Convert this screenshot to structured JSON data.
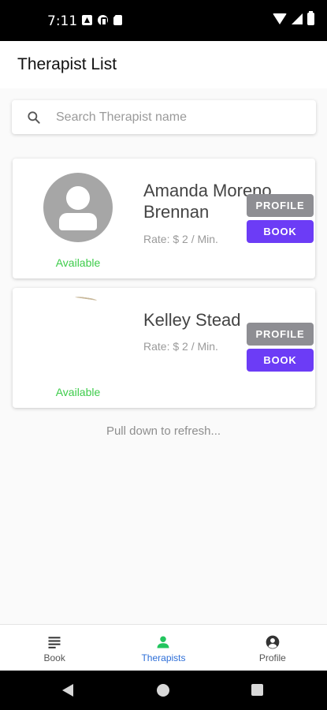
{
  "status_bar": {
    "time": "7:11"
  },
  "app_bar": {
    "title": "Therapist List"
  },
  "search": {
    "placeholder": "Search Therapist name",
    "value": ""
  },
  "therapists": [
    {
      "name_line1": "Amanda Moreno",
      "name_line2": "Brennan",
      "rate": "Rate: $ 2 / Min.",
      "availability": "Available",
      "profile_label": "PROFILE",
      "book_label": "BOOK"
    },
    {
      "name_line1": "Kelley Stead",
      "rate": "Rate: $ 2 / Min.",
      "availability": "Available",
      "profile_label": "PROFILE",
      "book_label": "BOOK"
    }
  ],
  "refresh_hint": "Pull down to refresh...",
  "bottom_nav": {
    "items": [
      {
        "label": "Book",
        "icon": "list-icon",
        "active": false
      },
      {
        "label": "Therapists",
        "icon": "person-icon",
        "active": true
      },
      {
        "label": "Profile",
        "icon": "account-circle-icon",
        "active": false
      }
    ]
  },
  "colors": {
    "accent_purple": "#6c3cf6",
    "profile_gray": "#8e8e93",
    "available_green": "#3dcc4a",
    "active_nav_blue": "#2e6fd8",
    "active_icon_green": "#22c55e"
  }
}
